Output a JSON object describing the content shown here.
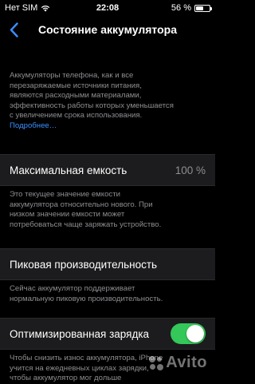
{
  "status_bar": {
    "carrier": "Нет SIM",
    "time": "22:08",
    "battery_text": "56 %",
    "battery_level": 0.56
  },
  "nav": {
    "title": "Состояние аккумулятора"
  },
  "intro": {
    "lines": [
      "Аккумуляторы телефона, как и все",
      "перезаряжаемые источники питания,",
      "являются расходными материалами,",
      "эффективность работы которых уменьшается",
      "с увеличением срока использования."
    ],
    "link": "Подробнее…"
  },
  "max_capacity": {
    "label": "Максимальная емкость",
    "value": "100 %",
    "note_lines": [
      "Это текущее значение емкости",
      "аккумулятора относительно нового. При",
      "низком значении емкости может",
      "потребоваться чаще заряжать устройство."
    ]
  },
  "peak_performance": {
    "label": "Пиковая производительность",
    "note_lines": [
      "Сейчас аккумулятор поддерживает",
      "нормальную пиковую производительность."
    ]
  },
  "optimized_charging": {
    "label": "Оптимизированная зарядка",
    "enabled": true,
    "note_lines": [
      "Чтобы снизить износ аккумулятора, iPhone",
      "учится на ежедневных циклах зарядки,",
      "чтобы аккумулятор мог дольше"
    ]
  },
  "watermark": {
    "text": "Avito"
  },
  "colors": {
    "background": "#000000",
    "cell": "#1c1c1e",
    "secondary_text": "#8e8e93",
    "link": "#3a8fff",
    "toggle_on": "#34c759"
  }
}
